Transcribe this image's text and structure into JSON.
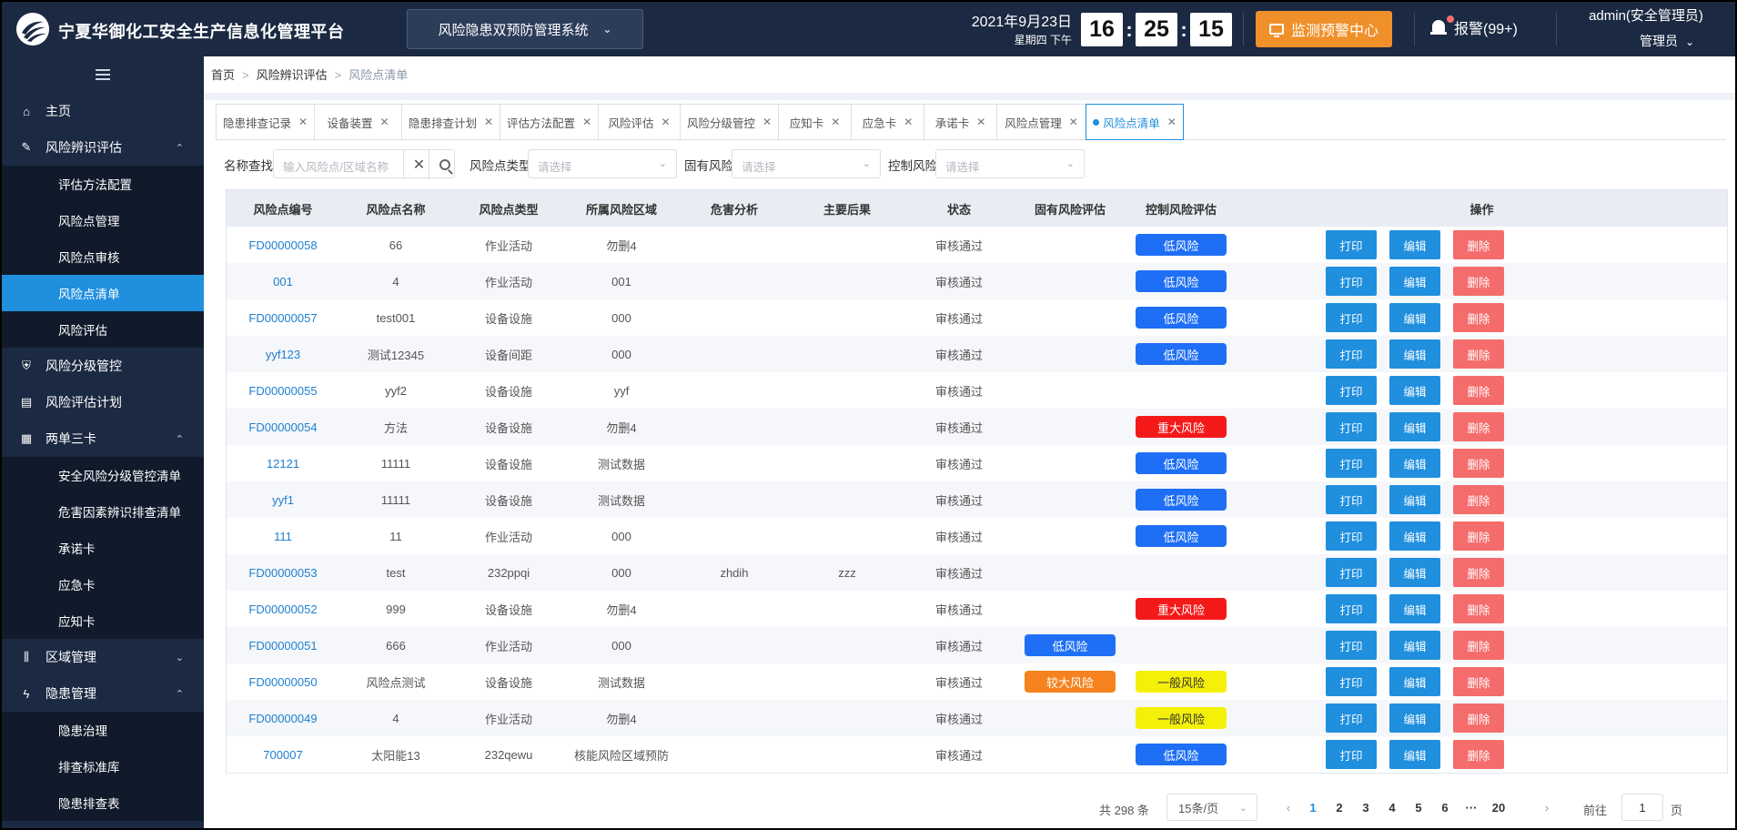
{
  "header": {
    "title": "宁夏华御化工安全生产信息化管理平台",
    "system_select": "风险隐患双预防管理系统",
    "date": "2021年9月23日",
    "weekday": "星期四  下午",
    "time": {
      "h": "16",
      "m": "25",
      "s": "15"
    },
    "monitor_label": "监测预警中心",
    "alarm_label": "报警(99+)",
    "user_name": "admin(安全管理员)",
    "user_role": "管理员",
    "colors": {
      "bg": "#1b2a42",
      "accent": "#f0902a"
    }
  },
  "sidebar": {
    "items": [
      {
        "label": "主页",
        "icon": "home-icon",
        "level": "top"
      },
      {
        "label": "风险辨识评估",
        "icon": "edit-icon",
        "level": "top",
        "arrow": "up"
      },
      {
        "label": "评估方法配置",
        "level": "sub"
      },
      {
        "label": "风险点管理",
        "level": "sub"
      },
      {
        "label": "风险点审核",
        "level": "sub"
      },
      {
        "label": "风险点清单",
        "level": "sub",
        "active": true
      },
      {
        "label": "风险评估",
        "level": "sub"
      },
      {
        "label": "风险分级管控",
        "icon": "shield-icon",
        "level": "top"
      },
      {
        "label": "风险评估计划",
        "icon": "document-icon",
        "level": "top"
      },
      {
        "label": "两单三卡",
        "icon": "clipboard-icon",
        "level": "top",
        "arrow": "up"
      },
      {
        "label": "安全风险分级管控清单",
        "level": "sub"
      },
      {
        "label": "危害因素辨识排查清单",
        "level": "sub"
      },
      {
        "label": "承诺卡",
        "level": "sub"
      },
      {
        "label": "应急卡",
        "level": "sub"
      },
      {
        "label": "应知卡",
        "level": "sub"
      },
      {
        "label": "区域管理",
        "icon": "bars-icon",
        "level": "top",
        "arrow": "down"
      },
      {
        "label": "隐患管理",
        "icon": "bolt-icon",
        "level": "top",
        "arrow": "up"
      },
      {
        "label": "隐患治理",
        "level": "sub"
      },
      {
        "label": "排查标准库",
        "level": "sub"
      },
      {
        "label": "隐患排查表",
        "level": "sub"
      }
    ],
    "active_color": "#1f8fde"
  },
  "breadcrumb": [
    "首页",
    "风险辨识评估",
    "风险点清单"
  ],
  "tabs": [
    {
      "label": "隐患排查记录",
      "w": 108
    },
    {
      "label": "设备装置",
      "w": 96
    },
    {
      "label": "隐患排查计划",
      "w": 108
    },
    {
      "label": "评估方法配置",
      "w": 108
    },
    {
      "label": "风险评估",
      "w": 90
    },
    {
      "label": "风险分级管控",
      "w": 108
    },
    {
      "label": "应知卡",
      "w": 80
    },
    {
      "label": "应急卡",
      "w": 80
    },
    {
      "label": "承诺卡",
      "w": 80
    },
    {
      "label": "风险点管理",
      "w": 98
    },
    {
      "label": "风险点清单",
      "w": 108,
      "active": true
    }
  ],
  "filters": {
    "name_label": "名称查找",
    "name_placeholder": "输入风险点/区域名称",
    "type_label": "风险点类型",
    "type_placeholder": "请选择",
    "inherent_label": "固有风险",
    "inherent_placeholder": "请选择",
    "control_label": "控制风险",
    "control_placeholder": "请选择"
  },
  "table": {
    "headers": [
      "风险点编号",
      "风险点名称",
      "风险点类型",
      "所属风险区域",
      "危害分析",
      "主要后果",
      "状态",
      "固有风险评估",
      "控制风险评估",
      "操作"
    ],
    "op_labels": {
      "print": "打印",
      "edit": "编辑",
      "delete": "删除"
    },
    "rows": [
      {
        "code": "FD00000058",
        "name": "66",
        "type": "作业活动",
        "area": "勿删4",
        "hazard": "",
        "result": "",
        "status": "审核通过",
        "inherent": null,
        "control": "低风险"
      },
      {
        "code": "001",
        "name": "4",
        "type": "作业活动",
        "area": "001",
        "hazard": "",
        "result": "",
        "status": "审核通过",
        "inherent": null,
        "control": "低风险"
      },
      {
        "code": "FD00000057",
        "name": "test001",
        "type": "设备设施",
        "area": "000",
        "hazard": "",
        "result": "",
        "status": "审核通过",
        "inherent": null,
        "control": "低风险"
      },
      {
        "code": "yyf123",
        "name": "测试12345",
        "type": "设备间距",
        "area": "000",
        "hazard": "",
        "result": "",
        "status": "审核通过",
        "inherent": null,
        "control": "低风险"
      },
      {
        "code": "FD00000055",
        "name": "yyf2",
        "type": "设备设施",
        "area": "yyf",
        "hazard": "",
        "result": "",
        "status": "审核通过",
        "inherent": null,
        "control": null
      },
      {
        "code": "FD00000054",
        "name": "方法",
        "type": "设备设施",
        "area": "勿删4",
        "hazard": "",
        "result": "",
        "status": "审核通过",
        "inherent": null,
        "control": "重大风险"
      },
      {
        "code": "12121",
        "name": "11111",
        "type": "设备设施",
        "area": "测试数据",
        "hazard": "",
        "result": "",
        "status": "审核通过",
        "inherent": null,
        "control": "低风险"
      },
      {
        "code": "yyf1",
        "name": "11111",
        "type": "设备设施",
        "area": "测试数据",
        "hazard": "",
        "result": "",
        "status": "审核通过",
        "inherent": null,
        "control": "低风险"
      },
      {
        "code": "111",
        "name": "11",
        "type": "作业活动",
        "area": "000",
        "hazard": "",
        "result": "",
        "status": "审核通过",
        "inherent": null,
        "control": "低风险"
      },
      {
        "code": "FD00000053",
        "name": "test",
        "type": "232ppqi",
        "area": "000",
        "hazard": "zhdih",
        "result": "zzz",
        "status": "审核通过",
        "inherent": null,
        "control": null
      },
      {
        "code": "FD00000052",
        "name": "999",
        "type": "设备设施",
        "area": "勿删4",
        "hazard": "",
        "result": "",
        "status": "审核通过",
        "inherent": null,
        "control": "重大风险"
      },
      {
        "code": "FD00000051",
        "name": "666",
        "type": "作业活动",
        "area": "000",
        "hazard": "",
        "result": "",
        "status": "审核通过",
        "inherent": "低风险",
        "control": null
      },
      {
        "code": "FD00000050",
        "name": "风险点测试",
        "type": "设备设施",
        "area": "测试数据",
        "hazard": "",
        "result": "",
        "status": "审核通过",
        "inherent": "较大风险",
        "control": "一般风险"
      },
      {
        "code": "FD00000049",
        "name": "4",
        "type": "作业活动",
        "area": "勿删4",
        "hazard": "",
        "result": "",
        "status": "审核通过",
        "inherent": null,
        "control": "一般风险"
      },
      {
        "code": "700007",
        "name": "太阳能13",
        "type": "232qewu",
        "area": "核能风险区域预防",
        "hazard": "",
        "result": "",
        "status": "审核通过",
        "inherent": null,
        "control": "低风险"
      }
    ],
    "risk_colors": {
      "低风险": "#1e6ff5",
      "重大风险": "#f51a1a",
      "较大风险": "#f5821e",
      "一般风险": "#f5f00a"
    }
  },
  "pagination": {
    "total": "共 298 条",
    "page_size": "15条/页",
    "pages": [
      "1",
      "2",
      "3",
      "4",
      "5",
      "6",
      "···",
      "20"
    ],
    "current": "1",
    "goto_label": "前往",
    "goto_value": "1",
    "page_suffix": "页"
  }
}
